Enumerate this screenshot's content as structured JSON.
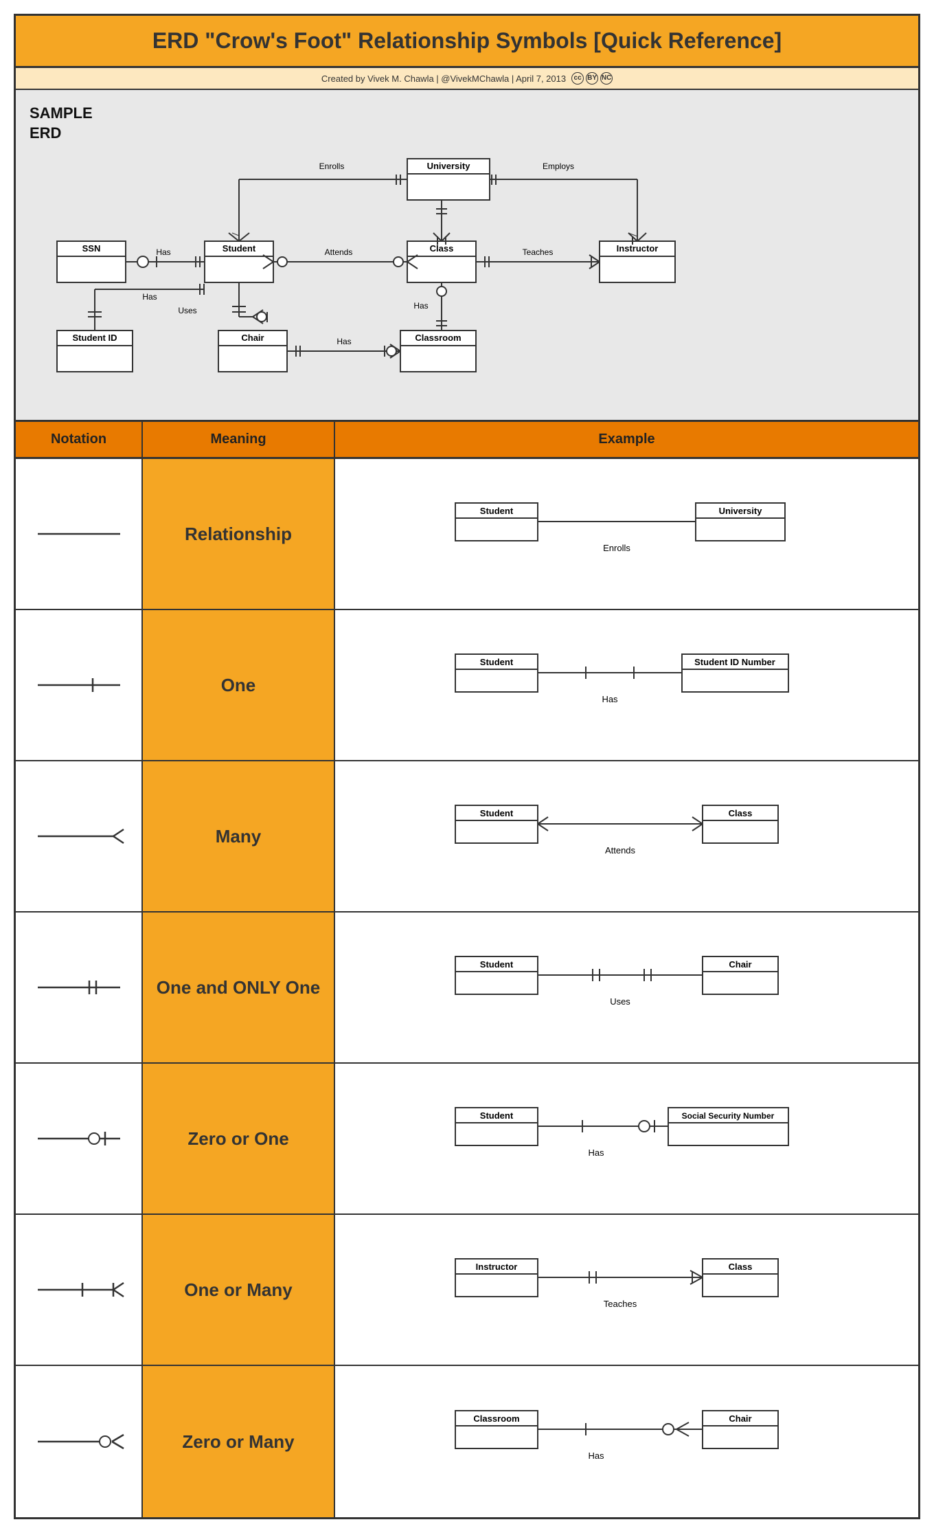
{
  "title": "ERD \"Crow's Foot\" Relationship Symbols [Quick Reference]",
  "credit": "Created by Vivek M. Chawla  |  @VivekMChawla  |  April 7, 2013",
  "erd_label": "SAMPLE\nERD",
  "table_header": {
    "notation": "Notation",
    "meaning": "Meaning",
    "example": "Example"
  },
  "rows": [
    {
      "meaning": "Relationship",
      "ex_left": "Student",
      "ex_right": "University",
      "ex_rel": "Enrolls",
      "notation_type": "relationship"
    },
    {
      "meaning": "One",
      "ex_left": "Student",
      "ex_right": "Student ID Number",
      "ex_rel": "Has",
      "notation_type": "one"
    },
    {
      "meaning": "Many",
      "ex_left": "Student",
      "ex_right": "Class",
      "ex_rel": "Attends",
      "notation_type": "many"
    },
    {
      "meaning": "One and ONLY One",
      "ex_left": "Student",
      "ex_right": "Chair",
      "ex_rel": "Uses",
      "notation_type": "one-only"
    },
    {
      "meaning": "Zero or One",
      "ex_left": "Student",
      "ex_right": "Social Security Number",
      "ex_rel": "Has",
      "notation_type": "zero-one"
    },
    {
      "meaning": "One or Many",
      "ex_left": "Instructor",
      "ex_right": "Class",
      "ex_rel": "Teaches",
      "notation_type": "one-many"
    },
    {
      "meaning": "Zero or Many",
      "ex_left": "Classroom",
      "ex_right": "Chair",
      "ex_rel": "Has",
      "notation_type": "zero-many"
    }
  ]
}
